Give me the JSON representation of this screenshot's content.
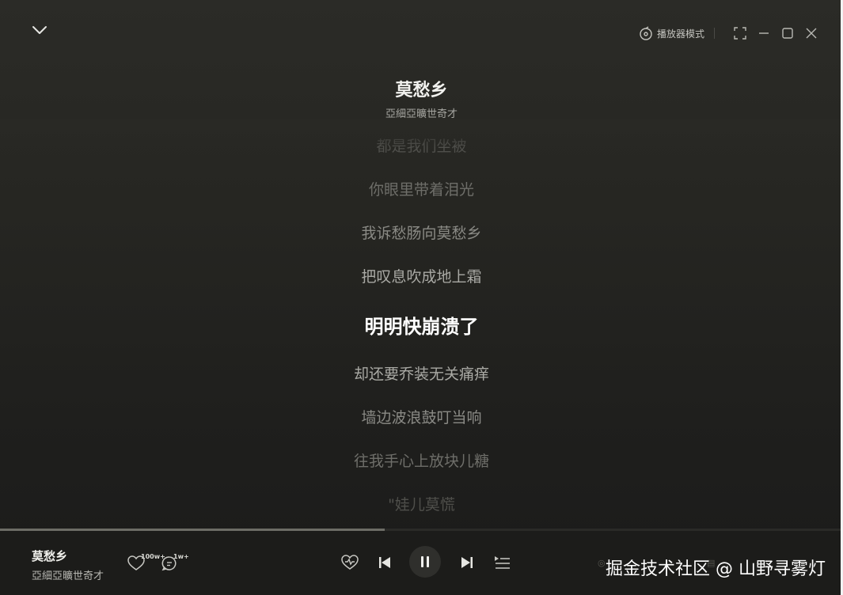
{
  "window": {
    "player_mode_label": "播放器模式"
  },
  "song": {
    "title": "莫愁乡",
    "artist": "亞細亞曠世奇才"
  },
  "lyrics": {
    "lines": [
      {
        "text": "都是我们坐被",
        "style": "fade2"
      },
      {
        "text": "你眼里带着泪光",
        "style": "fade1"
      },
      {
        "text": "我诉愁肠向莫愁乡",
        "style": "near"
      },
      {
        "text": "把叹息吹成地上霜",
        "style": "close"
      },
      {
        "text": "明明快崩溃了",
        "style": "active"
      },
      {
        "text": "却还要乔装无关痛痒",
        "style": "close"
      },
      {
        "text": "墙边波浪鼓叮当响",
        "style": "near"
      },
      {
        "text": "往我手心上放块儿糖",
        "style": "fade1"
      },
      {
        "text": "\"娃儿莫慌",
        "style": "fade2"
      }
    ]
  },
  "playback": {
    "progress": 0.456
  },
  "player_bar": {
    "title": "莫愁乡",
    "artist": "亞細亞曠世奇才",
    "like_count": "100w+",
    "comment_count": "1w+"
  },
  "watermark": "掘金技术社区 @ 山野寻雾灯",
  "colors": {
    "active_lyric": "#ffffff",
    "close_lyric": "#a9a9a4",
    "near_lyric": "#8a8a85",
    "fade1_lyric": "#6e6e69",
    "fade2_lyric": "#4f4f4b",
    "progress_fill": "#6c6c66"
  }
}
